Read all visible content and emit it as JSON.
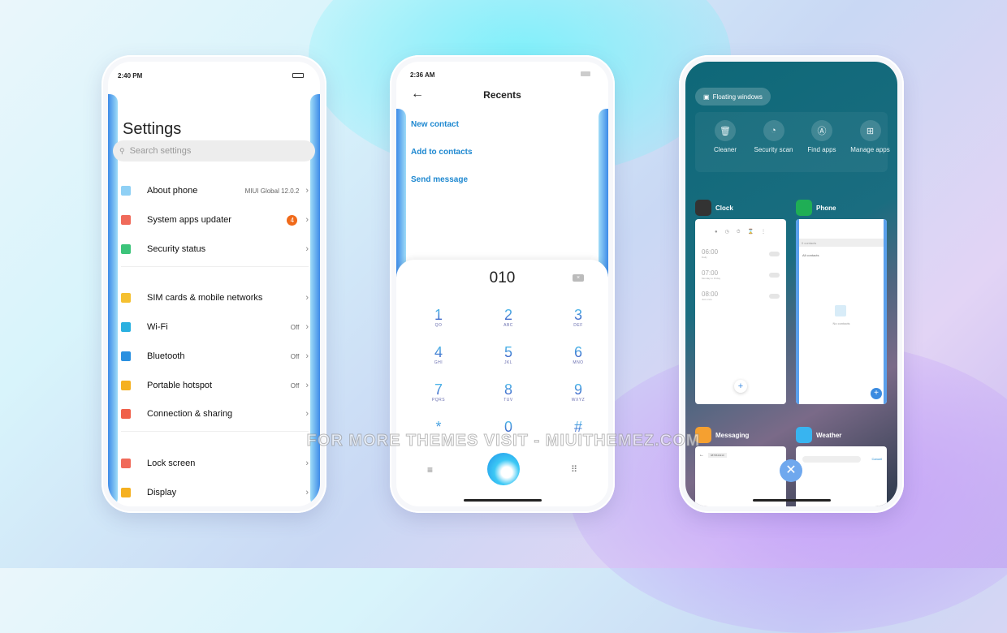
{
  "settings_phone": {
    "status_time": "2:40 PM",
    "title": "Settings",
    "search_placeholder": "Search settings",
    "items": [
      {
        "label": "About phone",
        "value": "MIUI Global 12.0.2",
        "icon": "phone-icon",
        "color": "#8fd0f5"
      },
      {
        "label": "System apps updater",
        "badge": "4",
        "icon": "arrow-up-icon",
        "color": "#f06a5a"
      },
      {
        "label": "Security status",
        "icon": "shield-check-icon",
        "color": "#3cc47a"
      },
      {
        "label": "SIM cards & mobile networks",
        "icon": "sim-icon",
        "color": "#f5c030"
      },
      {
        "label": "Wi-Fi",
        "value": "Off",
        "icon": "wifi-icon",
        "color": "#2ab0e0"
      },
      {
        "label": "Bluetooth",
        "value": "Off",
        "icon": "bluetooth-icon",
        "color": "#2a90e0"
      },
      {
        "label": "Portable hotspot",
        "value": "Off",
        "icon": "hotspot-icon",
        "color": "#f5b020"
      },
      {
        "label": "Connection & sharing",
        "icon": "share-icon",
        "color": "#f0604a"
      },
      {
        "label": "Lock screen",
        "icon": "lock-icon",
        "color": "#f06a5a"
      },
      {
        "label": "Display",
        "icon": "sun-icon",
        "color": "#f5b020"
      }
    ]
  },
  "dialer_phone": {
    "status_time": "2:36 AM",
    "title": "Recents",
    "actions": [
      "New contact",
      "Add to contacts",
      "Send message"
    ],
    "number": "010",
    "keys": [
      {
        "d": "1",
        "s": "QO"
      },
      {
        "d": "2",
        "s": "ABC"
      },
      {
        "d": "3",
        "s": "DEF"
      },
      {
        "d": "4",
        "s": "GHI"
      },
      {
        "d": "5",
        "s": "JKL"
      },
      {
        "d": "6",
        "s": "MNO"
      },
      {
        "d": "7",
        "s": "PQRS"
      },
      {
        "d": "8",
        "s": "TUV"
      },
      {
        "d": "9",
        "s": "WXYZ"
      },
      {
        "d": "*",
        "s": ""
      },
      {
        "d": "0",
        "s": "+"
      },
      {
        "d": "#",
        "s": ""
      }
    ]
  },
  "recents_phone": {
    "floating_windows": "Floating windows",
    "tools": [
      {
        "label": "Cleaner",
        "icon": "trash-icon"
      },
      {
        "label": "Security scan",
        "icon": "gauge-icon"
      },
      {
        "label": "Find apps",
        "icon": "search-app-icon"
      },
      {
        "label": "Manage apps",
        "icon": "grid-icon"
      }
    ],
    "apps": [
      {
        "name": "Clock",
        "color": "#333"
      },
      {
        "name": "Phone",
        "color": "#1fae55"
      },
      {
        "name": "Messaging",
        "color": "#f5a030"
      },
      {
        "name": "Weather",
        "color": "#38b4f0"
      }
    ],
    "alarms": [
      {
        "t": "06:00",
        "s": "Daily"
      },
      {
        "t": "07:00",
        "s": "Monday to Friday"
      },
      {
        "t": "08:00",
        "s": "Just once"
      }
    ],
    "phone_search": "0 contacts",
    "phone_filter": "All contacts",
    "no_contacts": "No contacts",
    "msg_number": "9876543210",
    "weather_cancel": "Cancel"
  },
  "watermark": "FOR MORE THEMES VISIT - MIUITHEMEZ.COM"
}
